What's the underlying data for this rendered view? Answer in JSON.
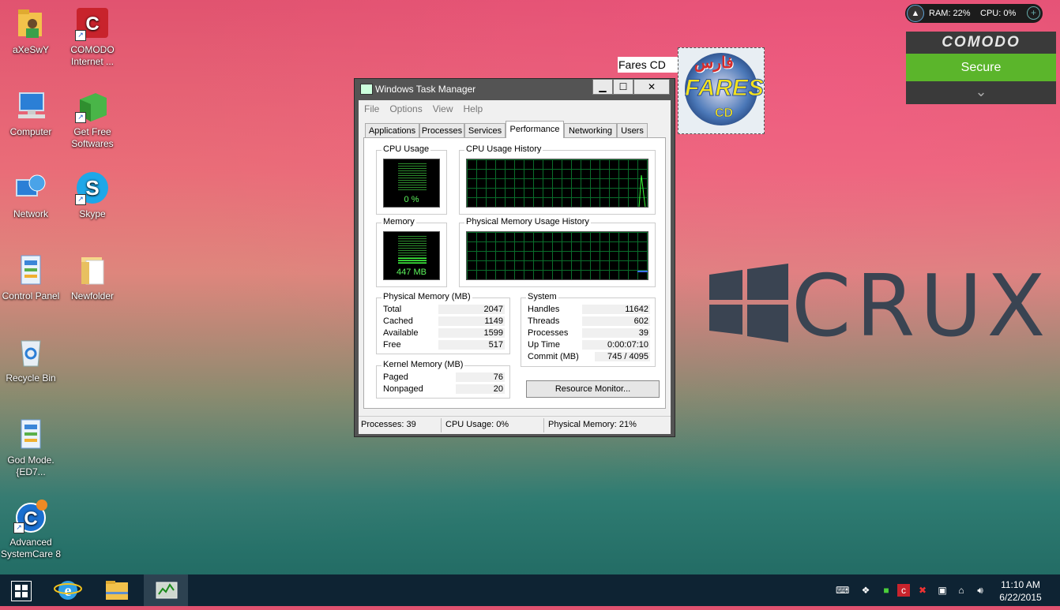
{
  "desktop": {
    "icons": [
      {
        "label": "aXeSwY"
      },
      {
        "label": "COMODO Internet ..."
      },
      {
        "label": "Computer"
      },
      {
        "label": "Get Free Softwares"
      },
      {
        "label": "Network"
      },
      {
        "label": "Skype"
      },
      {
        "label": "Control Panel"
      },
      {
        "label": "Newfolder"
      },
      {
        "label": "Recycle Bin"
      },
      {
        "label": "God Mode.{ED7..."
      },
      {
        "label": "Advanced SystemCare 8"
      }
    ],
    "wallpaper_logo": "CRUX"
  },
  "ram_widget": {
    "ram": "RAM: 22%",
    "cpu": "CPU: 0%"
  },
  "comodo_widget": {
    "brand": "COMODO",
    "status": "Secure"
  },
  "fares_widget": {
    "label": "Fares CD",
    "arabic": "فارس",
    "big": "FARES",
    "small": "CD"
  },
  "task_manager": {
    "title": "Windows Task Manager",
    "controls": {
      "min": "▁",
      "max": "☐",
      "close": "✕"
    },
    "menu": [
      "File",
      "Options",
      "View",
      "Help"
    ],
    "tabs": [
      "Applications",
      "Processes",
      "Services",
      "Performance",
      "Networking",
      "Users"
    ],
    "active_tab": "Performance",
    "cpu_usage": {
      "label": "CPU Usage",
      "value": "0 %",
      "fraction": 0.0
    },
    "cpu_history": {
      "label": "CPU Usage History"
    },
    "memory": {
      "label": "Memory",
      "value": "447 MB",
      "fraction": 0.21
    },
    "memory_history": {
      "label": "Physical Memory Usage History"
    },
    "physical_memory": {
      "label": "Physical Memory (MB)",
      "rows": [
        {
          "k": "Total",
          "v": "2047"
        },
        {
          "k": "Cached",
          "v": "1149"
        },
        {
          "k": "Available",
          "v": "1599"
        },
        {
          "k": "Free",
          "v": "517"
        }
      ]
    },
    "kernel_memory": {
      "label": "Kernel Memory (MB)",
      "rows": [
        {
          "k": "Paged",
          "v": "76"
        },
        {
          "k": "Nonpaged",
          "v": "20"
        }
      ]
    },
    "system": {
      "label": "System",
      "rows": [
        {
          "k": "Handles",
          "v": "11642"
        },
        {
          "k": "Threads",
          "v": "602"
        },
        {
          "k": "Processes",
          "v": "39"
        },
        {
          "k": "Up Time",
          "v": "0:00:07:10"
        },
        {
          "k": "Commit (MB)",
          "v": "745 / 4095"
        }
      ]
    },
    "resource_monitor_button": "Resource Monitor...",
    "status": {
      "processes": "Processes: 39",
      "cpu": "CPU Usage: 0%",
      "memory": "Physical Memory: 21%"
    }
  },
  "taskbar": {
    "time": "11:10 AM",
    "date": "6/22/2015"
  },
  "colors": {
    "accent_green": "#5bb52b",
    "graph_green": "#5df75d",
    "taskbar": "#0e2333"
  }
}
